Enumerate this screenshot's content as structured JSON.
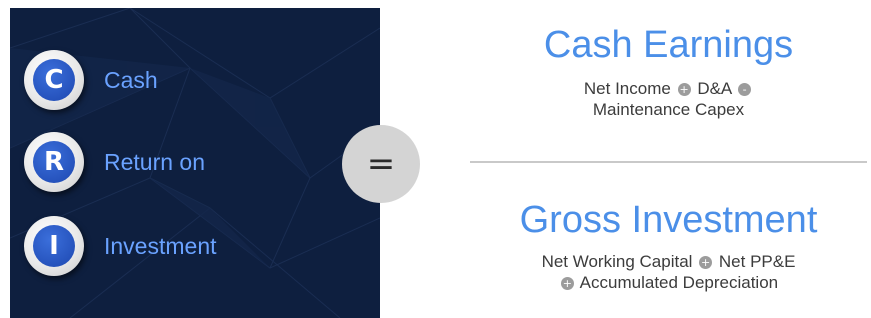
{
  "acronym": [
    {
      "letter": "C",
      "label": "Cash"
    },
    {
      "letter": "R",
      "label": "Return on"
    },
    {
      "letter": "I",
      "label": "Investment"
    }
  ],
  "equals_sign": "=",
  "numerator": {
    "title": "Cash Earnings",
    "line1": {
      "part1": "Net Income",
      "op1": "+",
      "part2": "D&A",
      "op2": "-"
    },
    "line2": "Maintenance Capex"
  },
  "denominator": {
    "title": "Gross Investment",
    "line1": {
      "part1": "Net Working Capital",
      "op1": "+",
      "part2": "Net PP&E"
    },
    "line2": {
      "op": "+",
      "text": "Accumulated Depreciation"
    }
  },
  "colors": {
    "panel_bg": "#0e1f3f",
    "badge_blue": "#1d47b0",
    "label_blue": "#6aa2ff",
    "heading_blue": "#4b8fe8"
  }
}
